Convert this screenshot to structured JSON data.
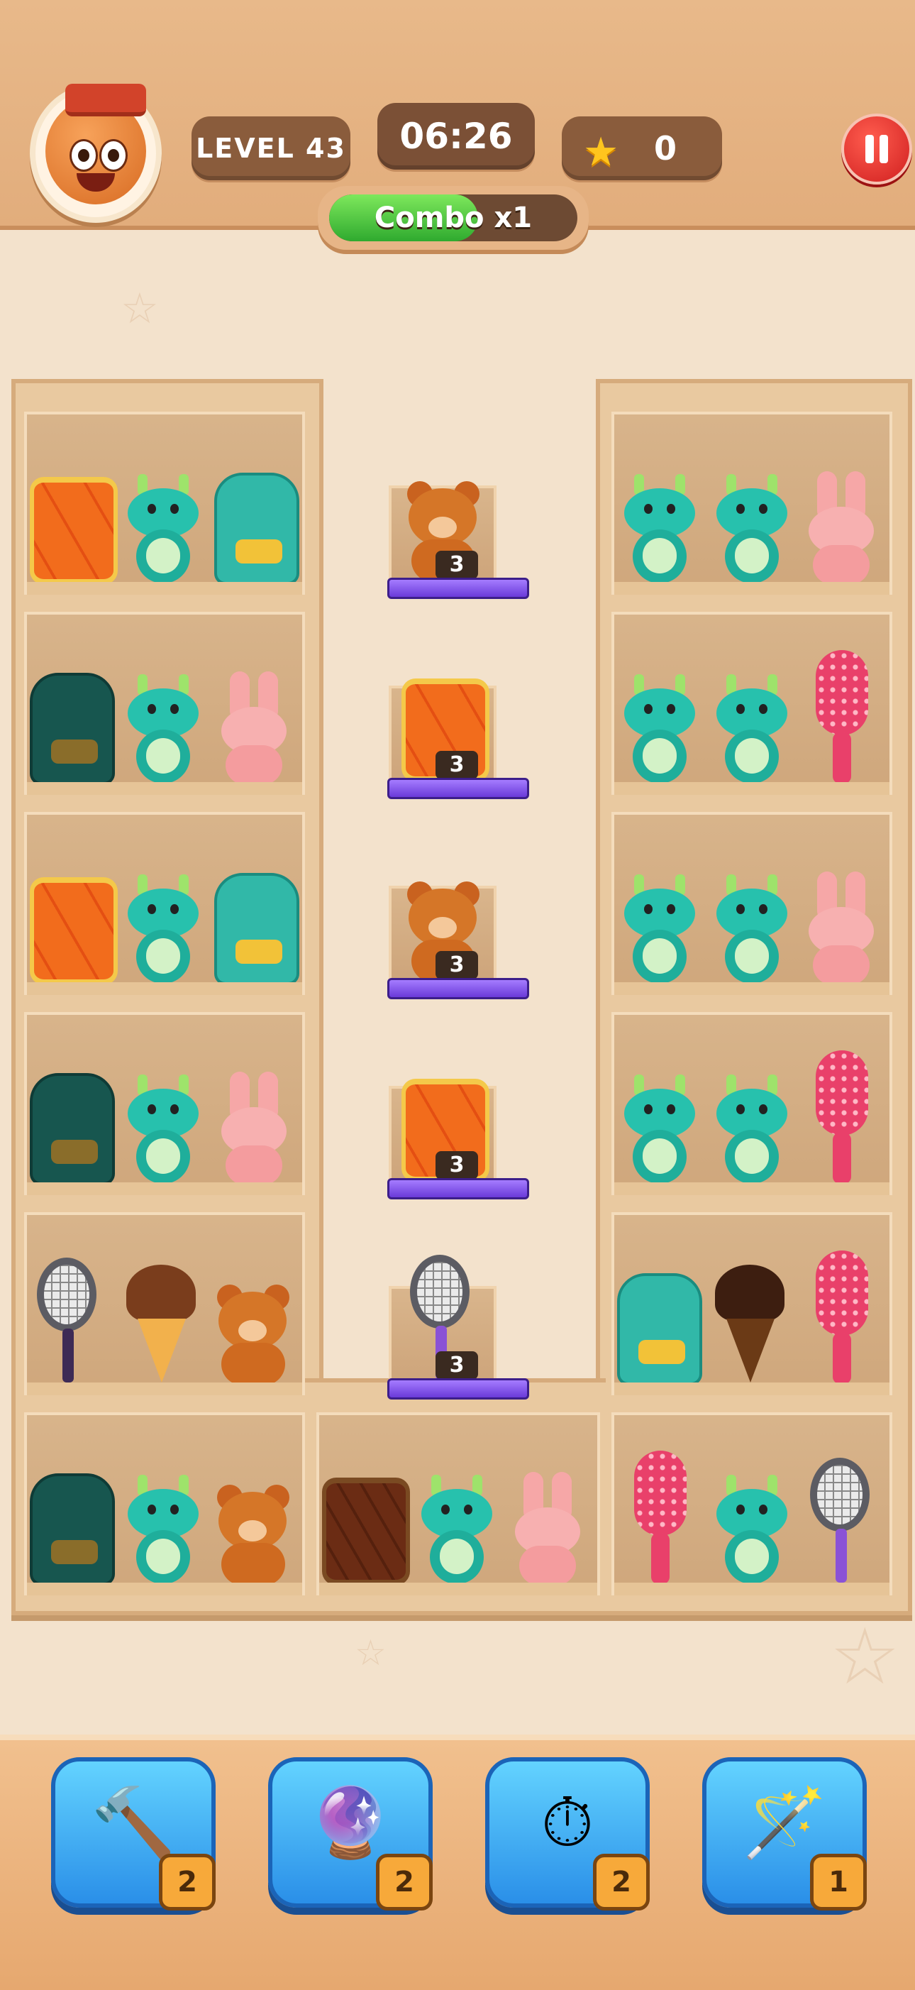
{
  "header": {
    "level_label": "LEVEL 43",
    "timer": "06:26",
    "stars_count": "0",
    "combo_label": "Combo x1",
    "combo_progress_pct": 60
  },
  "center_column": {
    "slots": [
      {
        "item": "bear",
        "count": "3"
      },
      {
        "item": "drum",
        "count": "3"
      },
      {
        "item": "bear",
        "count": "3"
      },
      {
        "item": "drum",
        "count": "3"
      },
      {
        "item": "racket",
        "count": "3"
      }
    ]
  },
  "boosters": [
    {
      "name": "hammer",
      "icon": "hammer-icon",
      "count": "2"
    },
    {
      "name": "shuffle",
      "icon": "star-orb-icon",
      "count": "2"
    },
    {
      "name": "freeze-time",
      "icon": "stopwatch-icon",
      "count": "2"
    },
    {
      "name": "magic-wand",
      "icon": "magic-wand-icon",
      "count": "1"
    }
  ],
  "colors": {
    "topbar": "#e2ad7c",
    "pill": "#8a5c3c",
    "pause": "#d01f1f",
    "combo_fill": "#2faa2f",
    "booster": "#2a8fe8",
    "lockbar": "#6a3ad9"
  }
}
